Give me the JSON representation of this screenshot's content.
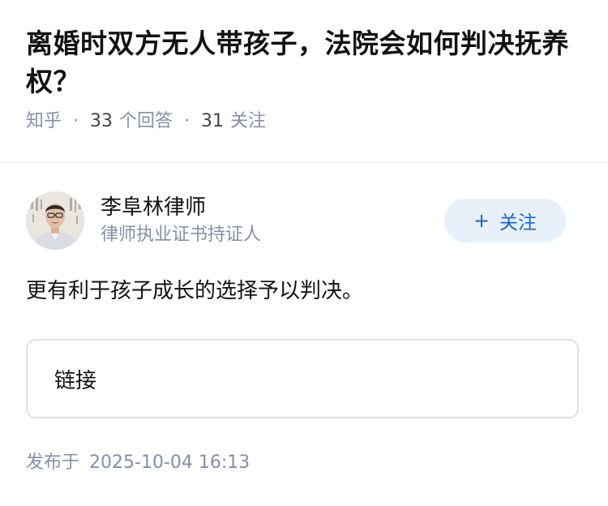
{
  "question": {
    "title": "离婚时双方无人带孩子，法院会如何判决抚养权？",
    "source": "知乎",
    "separator": "·",
    "answer_count": "33",
    "answer_label": "个回答",
    "follower_count": "31",
    "follower_label": "关注"
  },
  "author": {
    "name": "李阜林律师",
    "badge": "律师执业证书持证人",
    "avatar_icon": "avatar-photo",
    "follow_plus": "+",
    "follow_label": "关注",
    "follow_color": "#1767c9",
    "follow_bg": "#e8f0fa"
  },
  "answer": {
    "text": "更有利于孩子成长的选择予以判决。",
    "link_card_label": "链接",
    "publish_prefix": "发布于",
    "publish_time": "2025-10-04 16:13"
  }
}
